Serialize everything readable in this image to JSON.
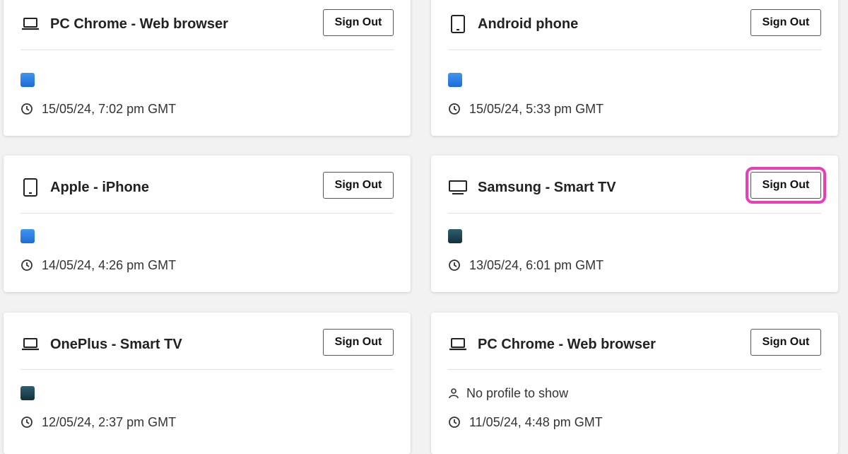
{
  "devices": [
    {
      "title": "PC Chrome - Web browser",
      "icon": "laptop-icon",
      "profile": "blue-profile-avatar",
      "time": "15/05/24, 7:02 pm GMT",
      "button": "Sign Out"
    },
    {
      "title": "Android phone",
      "icon": "phone-icon",
      "profile": "blue-profile-avatar",
      "time": "15/05/24, 5:33 pm GMT",
      "button": "Sign Out"
    },
    {
      "title": "Apple - iPhone",
      "icon": "phone-icon",
      "profile": "blue-profile-avatar",
      "time": "14/05/24, 4:26 pm GMT",
      "button": "Sign Out"
    },
    {
      "title": "Samsung - Smart TV",
      "icon": "tv-icon",
      "profile": "dark-profile-avatar",
      "time": "13/05/24, 6:01 pm GMT",
      "button": "Sign Out",
      "highlight_color": "#e83fb6"
    },
    {
      "title": "OnePlus - Smart TV",
      "icon": "laptop-icon",
      "profile": "dark-profile-avatar",
      "time": "12/05/24, 2:37 pm GMT",
      "button": "Sign Out"
    },
    {
      "title": "PC Chrome - Web browser",
      "icon": "laptop-icon",
      "profile_text": "No profile to show",
      "time": "11/05/24, 4:48 pm GMT",
      "button": "Sign Out"
    }
  ],
  "colors": {
    "accent_highlight": "#e83fb6",
    "profile_blue": "#2d82e6",
    "profile_dark": "#1f4654"
  }
}
